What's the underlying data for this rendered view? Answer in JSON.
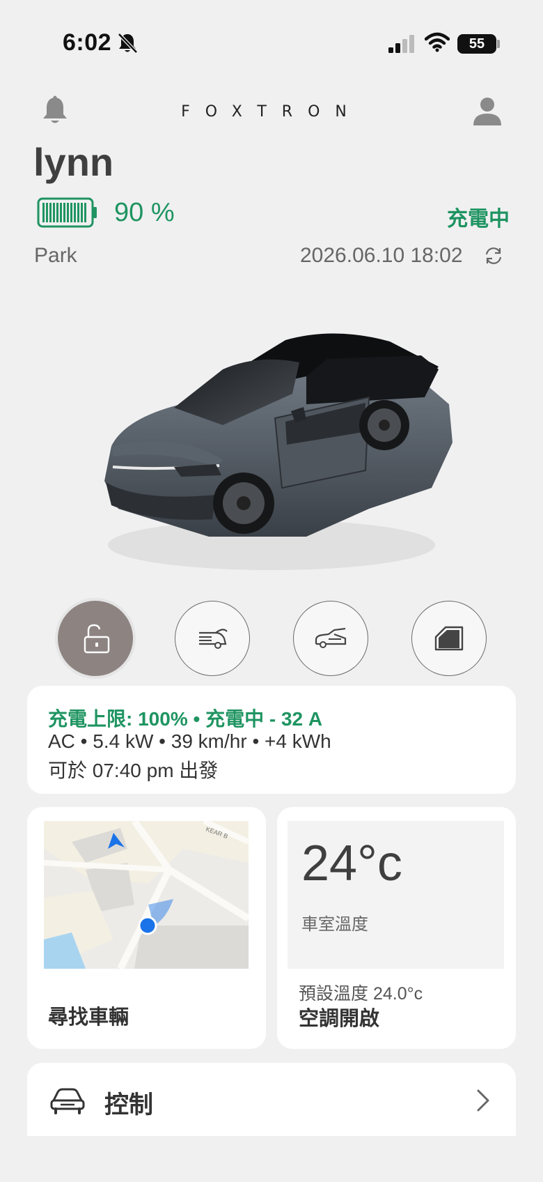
{
  "status_bar": {
    "time": "6:02",
    "battery": "55"
  },
  "header": {
    "logo": "FOXTRON"
  },
  "vehicle": {
    "name": "lynn",
    "battery_percent": "90 %",
    "battery_level": 0.9,
    "charging_status": "充電中",
    "gear": "Park",
    "updated_at": "2026.06.10 18:02"
  },
  "actions": [
    {
      "name": "unlock",
      "icon": "unlock-icon"
    },
    {
      "name": "trunk",
      "icon": "rear-trunk-icon"
    },
    {
      "name": "frunk",
      "icon": "front-trunk-icon"
    },
    {
      "name": "window",
      "icon": "window-icon"
    }
  ],
  "charge_card": {
    "title": "充電上限: 100% • 充電中 - 32 A",
    "detail": "AC • 5.4 kW • 39 km/hr • +4 kWh",
    "depart": "可於 07:40 pm 出發"
  },
  "map_card": {
    "street_label": "KEAR B",
    "label": "尋找車輛"
  },
  "climate_card": {
    "temperature": "24°c",
    "temperature_label": "車室溫度",
    "preset": "預設溫度 24.0°c",
    "status": "空調開啟"
  },
  "control_card": {
    "label": "控制"
  },
  "colors": {
    "accent_green": "#1f9461",
    "background": "#f0f0f1",
    "card": "#ffffff",
    "active_button": "#8d8482"
  }
}
